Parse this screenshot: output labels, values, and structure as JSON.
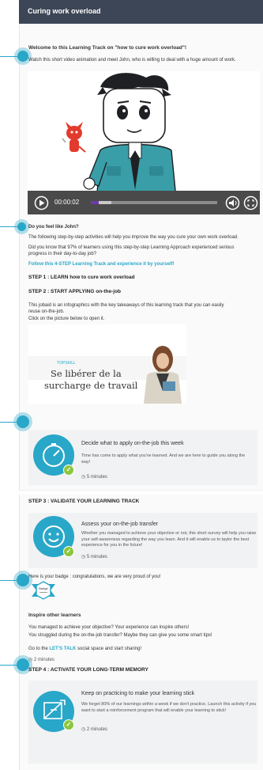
{
  "header": {
    "title": "Curing work overload"
  },
  "intro": {
    "welcome": "Welcome to this Learning Track on \"how to cure work overload\"!",
    "watch": "Watch this short video animation and meet John, who is willing to deal with a huge amount of work."
  },
  "video": {
    "time": "00:00:02",
    "progress": 0.06,
    "buffered": 0.16
  },
  "body": {
    "q": "Do you feel like John?",
    "p1": "The following step-by-step activities will help you improve the way you cure your own work overload.",
    "p2": "Did you know that 97% of learners using this step-by-step Learning Approach experienced serious progress in their day-to-day job?",
    "follow": "Follow this 4-STEP Learning Track and experience it by yourself!",
    "step1": "STEP 1 : LEARN how to cure work overload",
    "step2": "STEP 2 : START APPLYING on-the-job",
    "jobaid1": "This jobaid is an infographics with the key takeaways of this learning track that you can easily reuse on-the-job.",
    "jobaid2": "Click on the picture below to open it."
  },
  "infographic": {
    "brand": "TOPSKILL",
    "title_line1": "Se libérer de la",
    "title_line2": "surcharge de travail"
  },
  "activity1": {
    "title": "Decide what to apply on-the-job this week",
    "desc": "Time has come to apply what you've learned. And we are here to guide you along the way!",
    "duration": "5 minutes"
  },
  "step3": "STEP 3 : VALIDATE YOUR LEARNING TRACK",
  "activity2": {
    "title": "Assess your on-the-job transfer",
    "desc": "Whether you managed to achieve your objective or not, this short survey will help you raise your self-awareness regarding the way you learn. And it will enable us to taylor the best experience for you in the future!",
    "duration": "5 minutes"
  },
  "badge": {
    "text": "Here is your badge : congratulations, we are very proud of you!",
    "label": "Badge"
  },
  "inspire": {
    "title": "Inspire other learners",
    "l1": "You managed to achieve your objective? Your experience can inspire others!",
    "l2": "You struggled during the on-the-job transfer? Maybe they can give you some smart tips!",
    "l3_pre": "Go to the ",
    "l3_link": "LET'S TALK",
    "l3_post": " social space and  start sharing!",
    "duration": "2 minutes"
  },
  "step4": "STEP 4 : ACTIVATE YOUR LONG-TERM MEMORY",
  "activity3": {
    "title": "Keep on practicing to make your learning stick",
    "desc": "We forget 80% of our learnings within a week if we don't practice. Launch this activity if you want to start a reinforcement program that will enable your learning to stick!",
    "duration": "2 minutes"
  },
  "colors": {
    "header": "#3d4656",
    "accent": "#29a7c8",
    "check": "#8cc63f"
  }
}
